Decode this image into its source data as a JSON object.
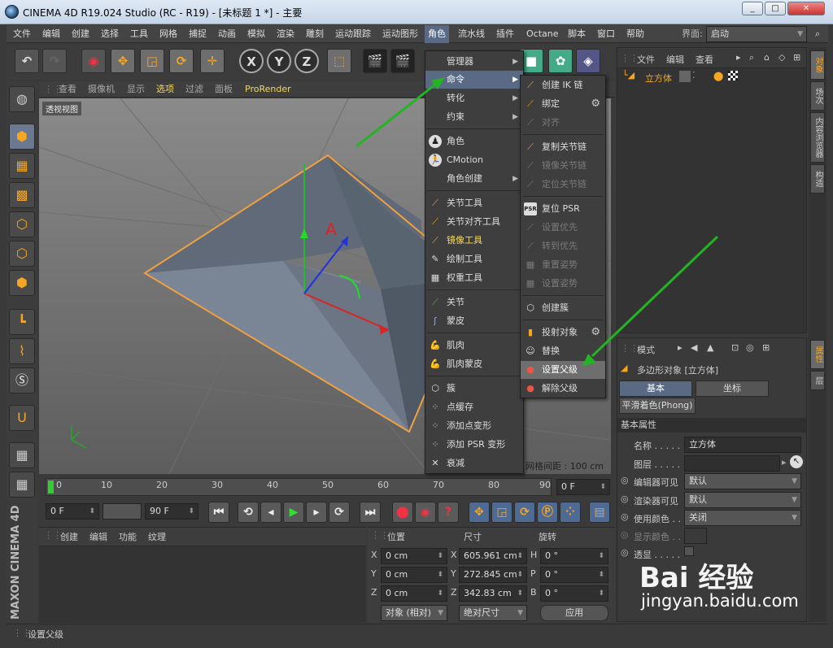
{
  "window": {
    "title": "CINEMA 4D R19.024 Studio (RC - R19) - [未标题 1 *] - 主要",
    "min": "_",
    "max": "□",
    "close": "✕"
  },
  "menubar": {
    "items": [
      "文件",
      "编辑",
      "创建",
      "选择",
      "工具",
      "网格",
      "捕捉",
      "动画",
      "模拟",
      "渲染",
      "雕刻",
      "运动跟踪",
      "运动图形",
      "角色",
      "流水线",
      "插件",
      "Octane",
      "脚本",
      "窗口",
      "帮助"
    ],
    "layout_label": "界面:",
    "layout_value": "启动"
  },
  "toolbar": {
    "x": "X",
    "y": "Y",
    "z": "Z"
  },
  "viewport_menu": [
    "查看",
    "摄像机",
    "显示",
    "选项",
    "过滤",
    "面板",
    "ProRender"
  ],
  "viewport": {
    "label": "透视视图",
    "grid": "网格间距 : 100 cm"
  },
  "timeline": {
    "ticks": [
      "0",
      "10",
      "20",
      "30",
      "40",
      "50",
      "60",
      "70",
      "80",
      "90"
    ],
    "frame_end_field": "0 F"
  },
  "transport": {
    "start": "0 F",
    "end": "90 F"
  },
  "material_menu": [
    "创建",
    "编辑",
    "功能",
    "纹理"
  ],
  "coord": {
    "headers": [
      "位置",
      "尺寸",
      "旋转"
    ],
    "rows": [
      {
        "axis": "X",
        "pos": "0 cm",
        "size_axis": "X",
        "size": "605.961 cm",
        "rot_axis": "H",
        "rot": "0 °"
      },
      {
        "axis": "Y",
        "pos": "0 cm",
        "size_axis": "Y",
        "size": "272.845 cm",
        "rot_axis": "P",
        "rot": "0 °"
      },
      {
        "axis": "Z",
        "pos": "0 cm",
        "size_axis": "Z",
        "size": "342.83 cm",
        "rot_axis": "B",
        "rot": "0 °"
      }
    ],
    "mode": "对象 (相对)",
    "size_mode": "绝对尺寸",
    "apply": "应用"
  },
  "objects": {
    "menu": [
      "文件",
      "编辑",
      "查看"
    ],
    "item": "立方体"
  },
  "attributes": {
    "menu": "模式",
    "title": "多边形对象 [立方体]",
    "tabs": [
      "基本",
      "坐标"
    ],
    "tag": "平滑着色(Phong)",
    "section": "基本属性",
    "fields": [
      {
        "label": "名称 . . . . .",
        "value": "立方体"
      },
      {
        "label": "图层 . . . . .",
        "value": ""
      },
      {
        "label": "编辑器可见",
        "value": "默认"
      },
      {
        "label": "渲染器可见",
        "value": "默认"
      },
      {
        "label": "使用颜色 . .",
        "value": "关闭"
      },
      {
        "label": "显示颜色 . .",
        "value": ""
      },
      {
        "label": "透显 . . . . .",
        "value": ""
      }
    ]
  },
  "right_tabs": [
    "对象",
    "场次",
    "内容浏览器",
    "构造",
    "属性",
    "层"
  ],
  "status": "设置父级",
  "character_menu": {
    "items": [
      "管理器",
      "命令",
      "转化",
      "约束",
      "角色",
      "CMotion",
      "角色创建",
      "关节工具",
      "关节对齐工具",
      "镜像工具",
      "绘制工具",
      "权重工具",
      "关节",
      "蒙皮",
      "肌肉",
      "肌肉蒙皮",
      "簇",
      "点缓存",
      "添加点变形",
      "添加 PSR 变形",
      "衰减"
    ]
  },
  "command_menu": {
    "items": [
      "创建 IK 链",
      "绑定",
      "对齐",
      "复制关节链",
      "镜像关节链",
      "定位关节链",
      "复位 PSR",
      "设置优先",
      "转到优先",
      "重置姿势",
      "设置姿势",
      "创建簇",
      "投射对象",
      "替换",
      "设置父级",
      "解除父级"
    ],
    "psr_icon": "PSR"
  },
  "watermark": {
    "main": "Bai 经验",
    "sub": "jingyan.baidu.com"
  },
  "colors": {
    "accent": "#5a6a84",
    "orange": "#f5a623",
    "arrow": "#22b522",
    "edge": "#f0a040"
  }
}
